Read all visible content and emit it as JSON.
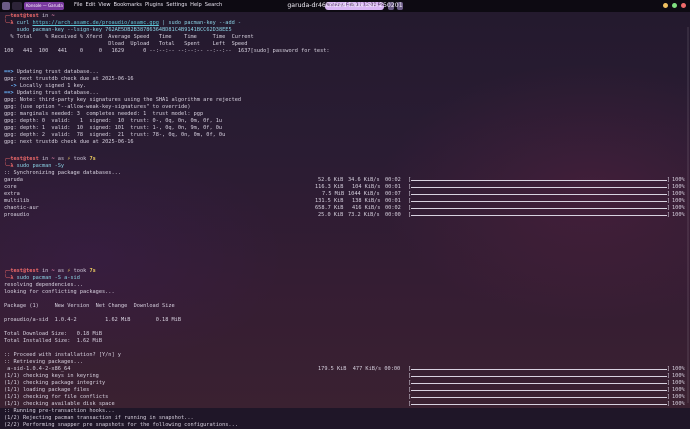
{
  "panel": {
    "menus": [
      "File",
      "Edit",
      "View",
      "Bookmarks",
      "Plugins",
      "Settings",
      "Help",
      "Search"
    ],
    "active_tab": "Konsole — Garuda",
    "window_title": "garuda-dr460nized-linux-zen-250201",
    "clock": "Monday, Feb 3 | 12:00 PM"
  },
  "colors": {
    "accent": "#d8b4f4",
    "close": "#ef6a6a",
    "minimize": "#f0c060",
    "maximize": "#7fe07f"
  },
  "icons": [
    "close-icon",
    "minimize-icon",
    "maximize-icon",
    "tray-icon"
  ],
  "block1": {
    "prompt_user": "test@test",
    "prompt_in": "in",
    "prompt_dir": "~",
    "cmd1_a": "curl ",
    "cmd1_url": "https://arch.asamc.de/proaudio/asamc.gpg",
    "cmd1_b": " | sudo pacman-key --add -",
    "cmd2_a": "sudo pacman-key --lsign-key ",
    "cmd2_key": "762AE5DB2B38786364BD81C4B9141BCC62D38EE5",
    "curl_header1": "% Total    % Received % Xferd  Average Speed   Time    Time     Time  Current",
    "curl_header2": "                                 Dload  Upload   Total   Spent    Left  Speed",
    "curl_row": "100   441  100   441    0     0   1629      0 --:--:-- --:--:-- --:--:--  1637[sudo] password for test:"
  },
  "trustdb1": {
    "l1": "Updating trust database...",
    "l2": "gpg: next trustdb check due at 2025-06-16",
    "l3": "Locally signed 1 key.",
    "l4": "Updating trust database...",
    "l5": "gpg: Note: third-party key signatures using the SHA1 algorithm are rejected",
    "l6": "gpg: (use option \"--allow-weak-key-signatures\" to override)",
    "l7": "gpg: marginals needed: 3  completes needed: 1  trust model: pgp",
    "l8": "gpg: depth: 0  valid:   1  signed:  10  trust: 0-, 0q, 0n, 0m, 0f, 1u",
    "l9": "gpg: depth: 1  valid:  10  signed: 101  trust: 1-, 0q, 0n, 9m, 0f, 0u",
    "l10": "gpg: depth: 2  valid:  78  signed:  21  trust: 78-, 0q, 0n, 0m, 0f, 0u",
    "l11": "gpg: next trustdb check due at 2025-06-16"
  },
  "block2": {
    "prompt_user": "test@test",
    "prompt_in": "in",
    "prompt_dir": "~",
    "as": "as",
    "took": "took",
    "took_val": "7s",
    "cmd": "sudo pacman -Sy",
    "sync": ":: Synchronizing package databases...",
    "repos": [
      {
        "name": "garuda",
        "size": "52.6 KiB",
        "speed": "34.6 KiB/s",
        "time": "00:02",
        "pct": "100%"
      },
      {
        "name": "core",
        "size": "116.3 KiB",
        "speed": "104 KiB/s",
        "time": "00:01",
        "pct": "100%"
      },
      {
        "name": "extra",
        "size": "7.5 MiB",
        "speed": "1044 KiB/s",
        "time": "00:07",
        "pct": "100%"
      },
      {
        "name": "multilib",
        "size": "131.5 KiB",
        "speed": "138 KiB/s",
        "time": "00:01",
        "pct": "100%"
      },
      {
        "name": "chaotic-aur",
        "size": "658.7 KiB",
        "speed": "416 KiB/s",
        "time": "00:02",
        "pct": "100%"
      },
      {
        "name": "proaudio",
        "size": "25.0 KiB",
        "speed": "73.2 KiB/s",
        "time": "00:00",
        "pct": "100%"
      }
    ]
  },
  "block3": {
    "prompt_user": "test@test",
    "prompt_in": "in",
    "prompt_dir": "~",
    "as": "as",
    "took": "took",
    "took_val": "7s",
    "cmd": "sudo pacman -S a-sid",
    "resolving": "resolving dependencies...",
    "conflicts": "looking for conflicting packages...",
    "table_header": "Package (1)     New Version  Net Change  Download Size",
    "table_row": "proaudio/a-sid  1.0.4-2         1.62 MiB        0.18 MiB",
    "total_dl": "Total Download Size:   0.18 MiB",
    "total_inst": "Total Installed Size:  1.62 MiB",
    "proceed": ":: Proceed with installation? [Y/n] y",
    "retrieving": ":: Retrieving packages...",
    "steps": [
      {
        "label": " a-sid-1.0.4-2-x86_64",
        "extra": "179.5 KiB  477 KiB/s 00:00",
        "pct": "100%"
      },
      {
        "label": "(1/1) checking keys in keyring",
        "extra": "",
        "pct": "100%"
      },
      {
        "label": "(1/1) checking package integrity",
        "extra": "",
        "pct": "100%"
      },
      {
        "label": "(1/1) loading package files",
        "extra": "",
        "pct": "100%"
      },
      {
        "label": "(1/1) checking for file conflicts",
        "extra": "",
        "pct": "100%"
      },
      {
        "label": "(1/1) checking available disk space",
        "extra": "",
        "pct": "100%"
      }
    ],
    "hooks": ":: Running pre-transaction hooks...",
    "hook1": "(1/2) Rejecting pacman transaction if running in snapshot...",
    "hook2": "(2/2) Performing snapper pre snapshots for the following configurations..."
  }
}
